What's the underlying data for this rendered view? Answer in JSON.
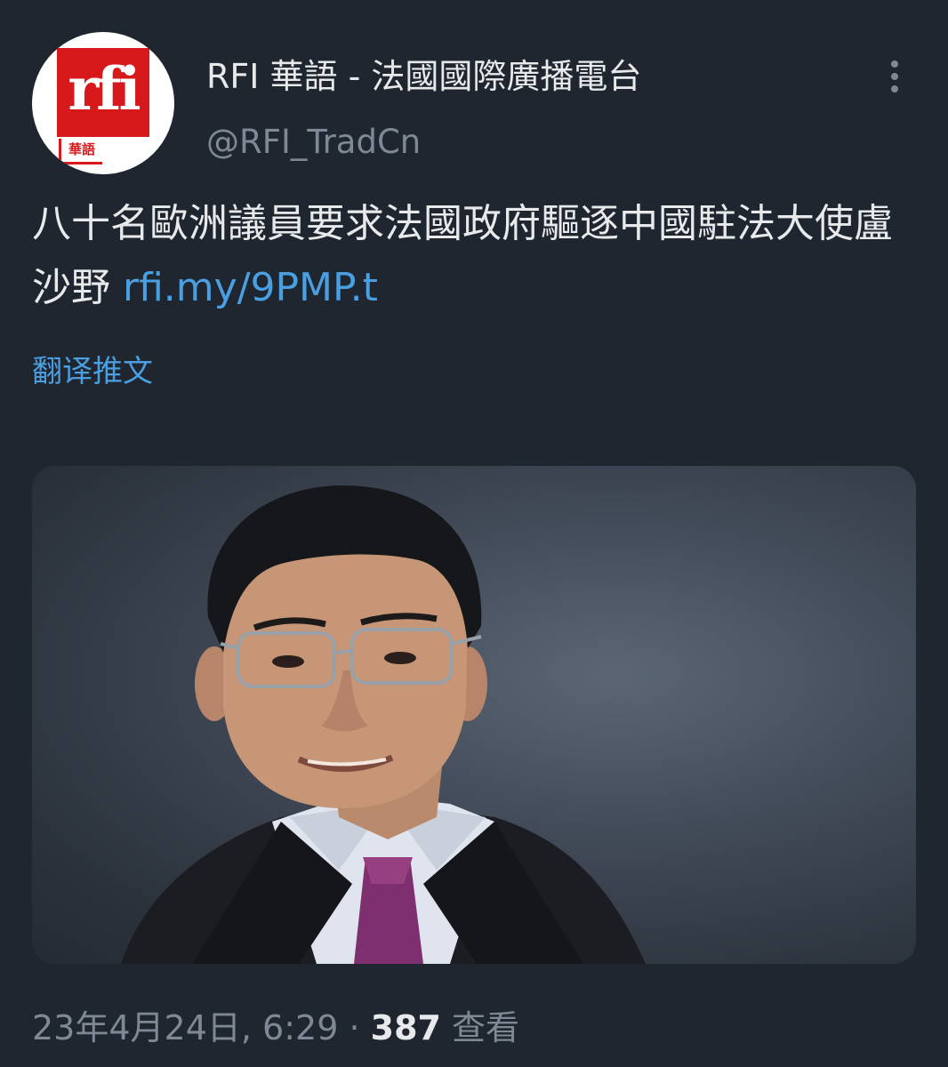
{
  "account": {
    "display_name": "RFI 華語 - 法國國際廣播電台",
    "handle": "@RFI_TradCn",
    "avatar_logo_text": "rfi",
    "avatar_logo_subtext": "華語"
  },
  "tweet": {
    "text": "八十名歐洲議員要求法國政府驅逐中國駐法大使盧沙野 ",
    "link": "rfi.my/9PMP.t",
    "translate_label": "翻译推文",
    "media_icon": "photo-portrait-man-in-suit"
  },
  "meta": {
    "timestamp": "23年4月24日, 6:29",
    "separator": " · ",
    "views_count": "387",
    "views_label": " 查看"
  },
  "colors": {
    "background": "#1f2630",
    "text": "#e7e9ea",
    "secondary_text": "#7f8894",
    "link": "#4a9fe0",
    "brand_red": "#d7191c"
  }
}
